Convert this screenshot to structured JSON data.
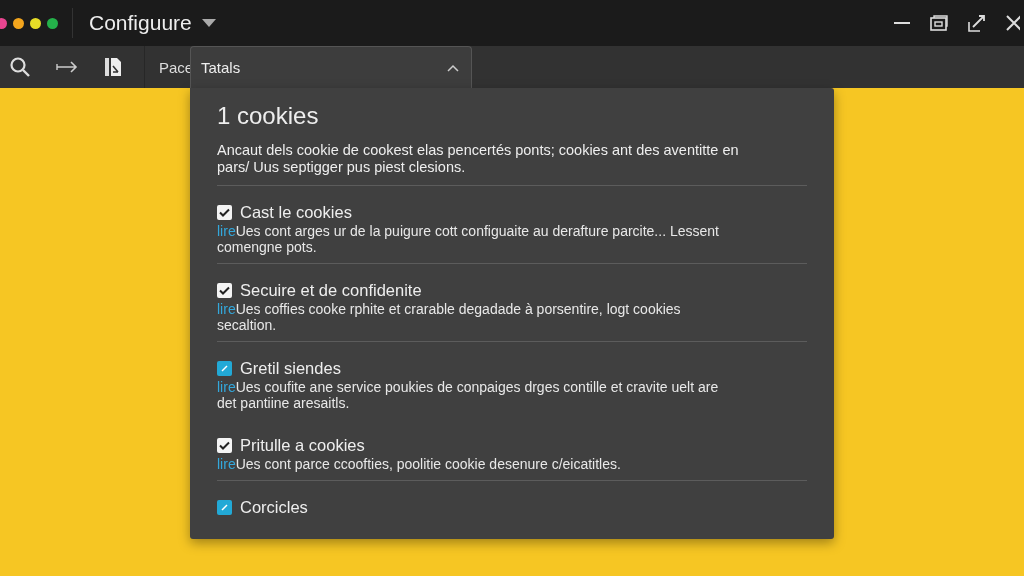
{
  "window": {
    "title": "Configuure"
  },
  "toolbar": {
    "label": "Pace"
  },
  "popup": {
    "tab": "Tatals",
    "expanded": true,
    "heading": "1 cookies",
    "intro": "Ancaut dels cookie de cookest elas pencertés ponts; cookies ant des aventitte en pars/ Uus septigger pus piest clesions.",
    "options": [
      {
        "label": "Cast le cookies",
        "checked": true,
        "kind": "plain",
        "link": "lire",
        "description": "Ues cont arges ur de la puigure cott configuaite au derafture parcite... Lessent comengne pots.",
        "divider": true
      },
      {
        "label": "Secuire et de confidenite",
        "checked": true,
        "kind": "plain",
        "link": "lire",
        "description": "Ues coffies cooke rphite et crarable degadade à porsentire, logt cookies secaltion.",
        "divider": true
      },
      {
        "label": "Gretil siendes",
        "checked": true,
        "kind": "accent",
        "link": "lire",
        "description": "Ues coufite ane service poukies de conpaiges drges contille et cravite uelt are det pantiine aresaitls.",
        "divider": false
      },
      {
        "label": "Pritulle a cookies",
        "checked": true,
        "kind": "plain",
        "link": "lire",
        "description": "Ues cont parce ccoofties, poolitie cookie desenure c/eicatitles.",
        "divider": true
      },
      {
        "label": "Corcicles",
        "checked": true,
        "kind": "accent"
      }
    ]
  }
}
